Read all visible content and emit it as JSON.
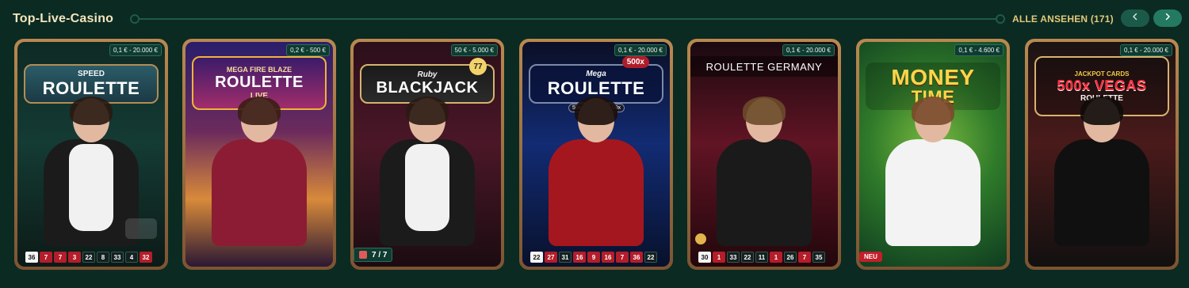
{
  "header": {
    "title": "Top-Live-Casino",
    "see_all": "ALLE ANSEHEN (171)",
    "prev_icon": "chevron-left-icon",
    "next_icon": "chevron-right-icon"
  },
  "games": [
    {
      "name": "Speed Roulette",
      "limit": "0,1 € - 20.000 €",
      "logo_line1": "SPEED",
      "logo_line2": "ROULETTE",
      "results": [
        {
          "v": "36",
          "c": "first"
        },
        {
          "v": "7",
          "c": "red"
        },
        {
          "v": "7",
          "c": "red"
        },
        {
          "v": "3",
          "c": "red"
        },
        {
          "v": "22",
          "c": "black"
        },
        {
          "v": "8",
          "c": "black"
        },
        {
          "v": "33",
          "c": "black"
        },
        {
          "v": "4",
          "c": "black"
        },
        {
          "v": "32",
          "c": "red"
        }
      ]
    },
    {
      "name": "Mega Fire Blaze Roulette Live",
      "limit": "0,2 € - 500 €",
      "logo_line1": "MEGA FIRE BLAZE",
      "logo_line2": "ROULETTE",
      "logo_line3": "LIVE",
      "results": []
    },
    {
      "name": "Ruby Blackjack",
      "limit": "50 € - 5.000 €",
      "logo_line1": "Ruby",
      "logo_line2": "BLACKJACK",
      "badge": "77",
      "seats": "7 / 7"
    },
    {
      "name": "Mega Roulette",
      "limit": "0,1 € - 20.000 €",
      "logo_line1": "Mega",
      "logo_line2": "ROULETTE",
      "mult1": "500x",
      "mult2": "50x",
      "mult3": "100x",
      "results": [
        {
          "v": "22",
          "c": "first"
        },
        {
          "v": "27",
          "c": "red"
        },
        {
          "v": "31",
          "c": "black"
        },
        {
          "v": "16",
          "c": "red"
        },
        {
          "v": "9",
          "c": "red"
        },
        {
          "v": "16",
          "c": "red"
        },
        {
          "v": "7",
          "c": "red"
        },
        {
          "v": "36",
          "c": "red"
        },
        {
          "v": "22",
          "c": "black"
        }
      ]
    },
    {
      "name": "Roulette Germany",
      "limit": "0,1 € - 20.000 €",
      "logo_line1": "ROULETTE GERMANY",
      "results": [
        {
          "v": "30",
          "c": "first"
        },
        {
          "v": "1",
          "c": "red"
        },
        {
          "v": "33",
          "c": "black"
        },
        {
          "v": "22",
          "c": "black"
        },
        {
          "v": "11",
          "c": "black"
        },
        {
          "v": "1",
          "c": "red"
        },
        {
          "v": "26",
          "c": "black"
        },
        {
          "v": "7",
          "c": "red"
        },
        {
          "v": "35",
          "c": "black"
        }
      ]
    },
    {
      "name": "Money Time",
      "limit": "0,1 € - 4.600 €",
      "logo_line1": "MONEY",
      "logo_line2": "TIME",
      "new_badge": "NEU"
    },
    {
      "name": "Jackpot Cards 500x Vegas Roulette",
      "limit": "0,1 € - 20.000 €",
      "logo_line1": "JACKPOT CARDS",
      "logo_line2": "500x VEGAS",
      "logo_line3": "ROULETTE"
    }
  ]
}
